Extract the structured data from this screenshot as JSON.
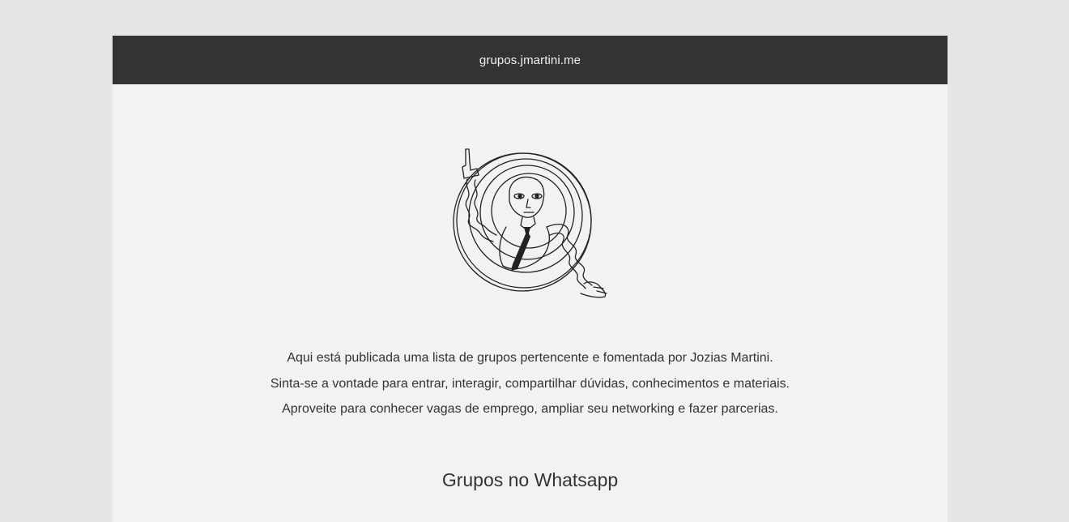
{
  "header": {
    "site_title": "grupos.jmartini.me"
  },
  "hero": {
    "illustration": "man-with-tie-and-circles-illustration"
  },
  "intro": {
    "lines": [
      "Aqui está publicada uma lista de grupos pertencente e fomentada por Jozias Martini.",
      "Sinta-se a vontade para entrar, interagir, compartilhar dúvidas, conhecimentos e materiais.",
      "Aproveite para conhecer vagas de emprego, ampliar seu networking e fazer parcerias."
    ]
  },
  "sections": {
    "whatsapp_title": "Grupos no Whatsapp"
  },
  "colors": {
    "background": "#e6e6e6",
    "page": "#f2f2f2",
    "header": "#333333",
    "text": "#333333"
  }
}
